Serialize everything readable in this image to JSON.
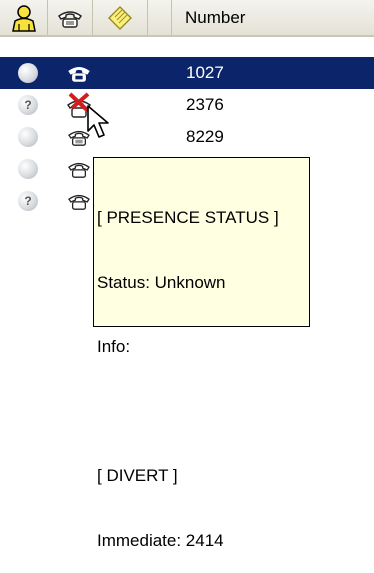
{
  "header": {
    "columns": [
      {
        "type": "icon",
        "icon": "person-icon",
        "label": ""
      },
      {
        "type": "icon",
        "icon": "phone-icon",
        "label": ""
      },
      {
        "type": "icon",
        "icon": "note-icon",
        "label": ""
      },
      {
        "type": "text",
        "label": "Number"
      }
    ]
  },
  "rows": [
    {
      "status": "available-circle",
      "device": "phone-icon",
      "number": "1027",
      "selected": true
    },
    {
      "status": "unknown-question-circle",
      "device": "phone-crossed-icon",
      "number": "2376",
      "selected": false
    },
    {
      "status": "available-circle",
      "device": "phone-icon",
      "number": "8229",
      "selected": false
    },
    {
      "status": "available-circle",
      "device": "phone-icon",
      "number": "",
      "selected": false
    },
    {
      "status": "unknown-question-circle",
      "device": "phone-icon",
      "number": "",
      "selected": false
    }
  ],
  "tooltip": {
    "lines": [
      "[ PRESENCE STATUS ]",
      "Status: Unknown",
      "Info:",
      "",
      "[ DIVERT ]",
      "Immediate: 2414"
    ]
  },
  "colors": {
    "selection": "#0b246a",
    "tooltip_bg": "#ffffe1",
    "header_bg": "#ece9d8"
  }
}
